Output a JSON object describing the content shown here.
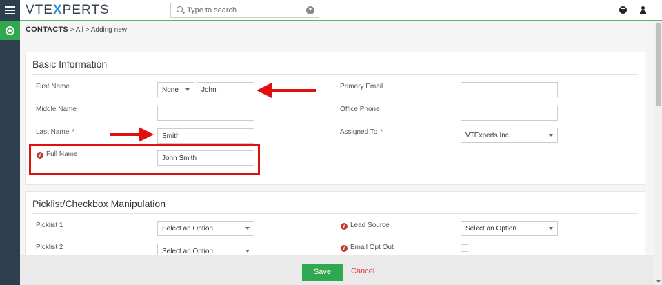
{
  "app": {
    "logo_left": "VTE",
    "logo_mid": "X",
    "logo_right": "PERTS"
  },
  "search": {
    "placeholder": "Type to search"
  },
  "breadcrumb": {
    "module": "CONTACTS",
    "sep1": ">",
    "all": "All",
    "sep2": ">",
    "current": "Adding new"
  },
  "basic_info": {
    "title": "Basic Information",
    "first_name": {
      "label": "First Name",
      "salutation": "None",
      "value": "John"
    },
    "middle_name": {
      "label": "Middle Name",
      "value": ""
    },
    "last_name": {
      "label": "Last Name",
      "required": "*",
      "value": "Smith"
    },
    "full_name": {
      "label": "Full Name",
      "value": "John  Smith"
    },
    "primary_email": {
      "label": "Primary Email",
      "value": ""
    },
    "office_phone": {
      "label": "Office Phone",
      "value": ""
    },
    "assigned_to": {
      "label": "Assigned To",
      "required": "*",
      "value": "VTExperts Inc."
    }
  },
  "picklist": {
    "title": "Picklist/Checkbox Manipulation",
    "picklist1": {
      "label": "Picklist 1",
      "value": "Select an Option"
    },
    "picklist2": {
      "label": "Picklist 2",
      "value": "Select an Option"
    },
    "lead_source": {
      "label": "Lead Source",
      "value": "Select an Option"
    },
    "email_opt_out": {
      "label": "Email Opt Out"
    }
  },
  "footer": {
    "save_label": "Save",
    "cancel_label": "Cancel"
  },
  "colors": {
    "accent": "#2fa84f",
    "sidebar": "#2d3e4f",
    "annotation": "#e01010",
    "required": "#ee3333"
  }
}
